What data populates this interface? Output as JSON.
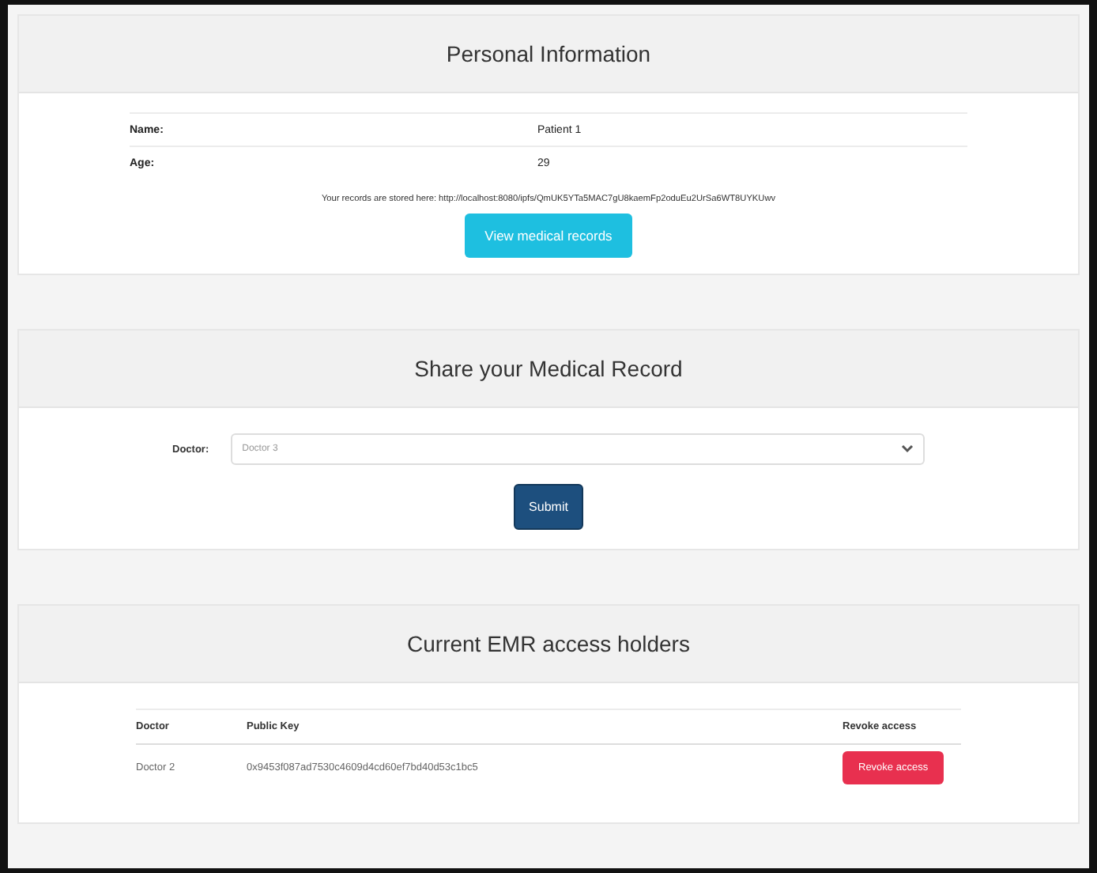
{
  "personal": {
    "title": "Personal Information",
    "fields": [
      {
        "label": "Name:",
        "value": "Patient 1"
      },
      {
        "label": "Age:",
        "value": "29"
      }
    ],
    "records_text": "Your records are stored here: http://localhost:8080/ipfs/QmUK5YTa5MAC7gU8kaemFp2oduEu2UrSa6WT8UYKUwv",
    "view_button": "View medical records"
  },
  "share": {
    "title": "Share your Medical Record",
    "doctor_label": "Doctor:",
    "doctor_value": "Doctor 3",
    "submit": "Submit"
  },
  "holders": {
    "title": "Current EMR access holders",
    "columns": [
      "Doctor",
      "Public Key",
      "Revoke access"
    ],
    "rows": [
      {
        "doctor": "Doctor 2",
        "key": "0x9453f087ad7530c4609d4cd60ef7bd40d53c1bc5",
        "action": "Revoke access"
      }
    ]
  }
}
